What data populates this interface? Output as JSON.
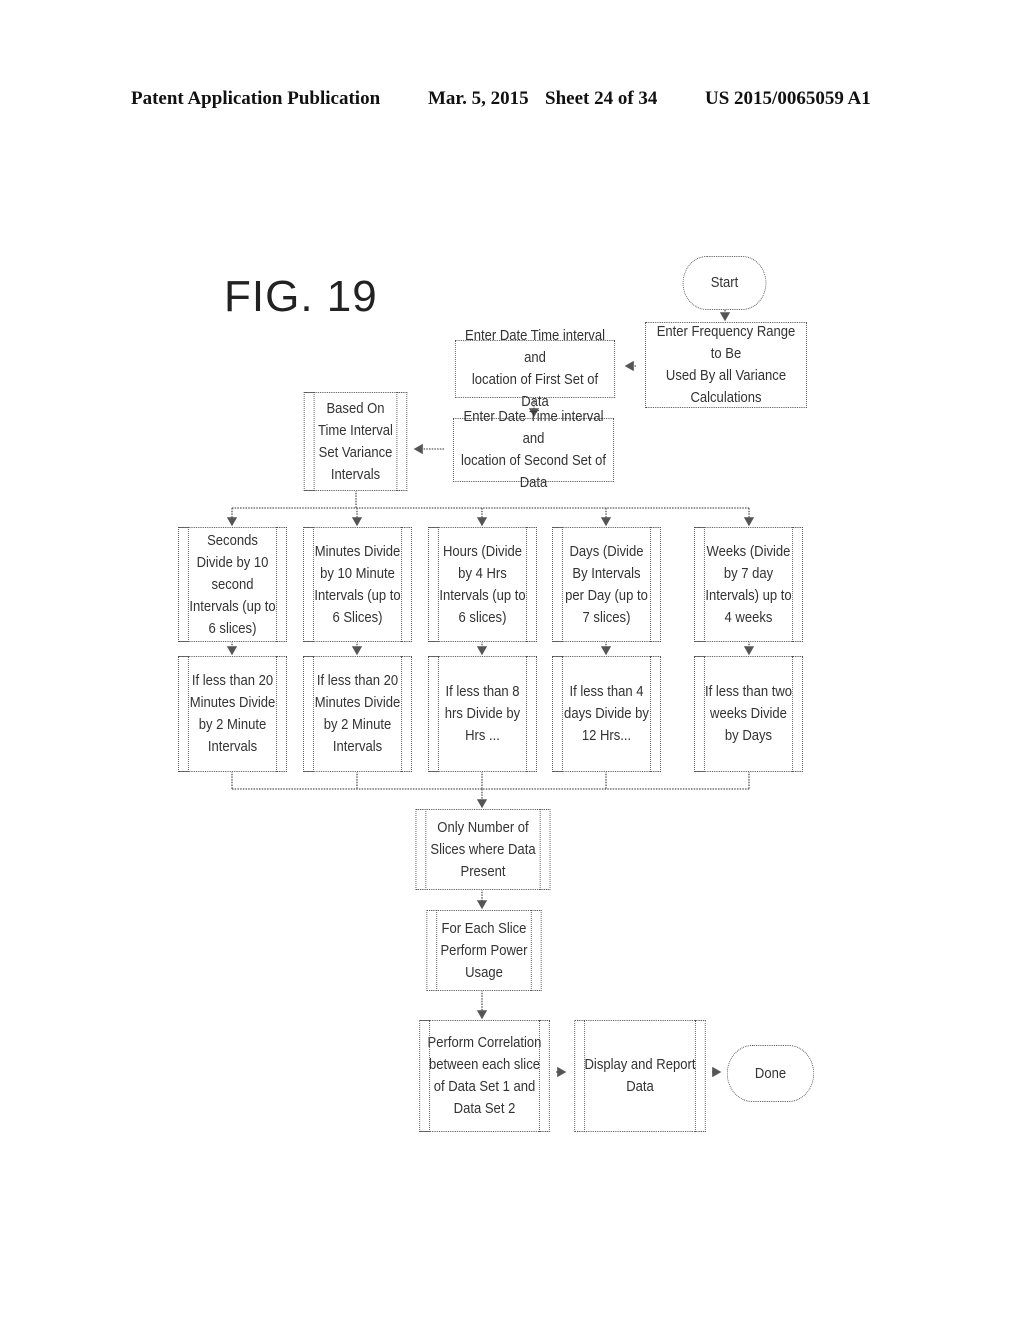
{
  "header": {
    "publication": "Patent Application Publication",
    "date": "Mar. 5, 2015",
    "sheet": "Sheet 24 of 34",
    "number": "US 2015/0065059 A1"
  },
  "figure_label": "FIG. 19",
  "flowchart": {
    "start": "Start",
    "frequency_range": "Enter Frequency Range to Be\nUsed By all Variance\nCalculations",
    "first_set": "Enter Date Time interval and\nlocation of First Set of Data",
    "second_set": "Enter Date Time interval and\nlocation of Second Set of Data",
    "set_intervals": "Based On\nTime Interval\nSet  Variance\nIntervals",
    "branches": [
      {
        "primary": "Seconds\nDivide by 10\nsecond\nIntervals (up to\n6 slices)",
        "secondary": "If less than 20\nMinutes Divide\nby 2 Minute\nIntervals"
      },
      {
        "primary": "Minutes Divide\nby 10 Minute\nIntervals (up to\n6 Slices)",
        "secondary": "If less than 20\nMinutes Divide\nby 2 Minute\nIntervals"
      },
      {
        "primary": "Hours (Divide\nby 4 Hrs\nIntervals (up to\n6 slices)",
        "secondary": "If less than 8\nhrs Divide by\nHrs ..."
      },
      {
        "primary": "Days (Divide\nBy Intervals\nper Day (up to\n7 slices)",
        "secondary": "If less than 4\ndays Divide by\n12 Hrs..."
      },
      {
        "primary": "Weeks (Divide\nby 7 day\nIntervals) up to\n4 weeks",
        "secondary": "If less than two\nweeks Divide\nby Days"
      }
    ],
    "slices_present": "Only Number of\nSlices where Data\nPresent",
    "power_usage": "For Each Slice\nPerform Power\nUsage",
    "correlation": "Perform Correlation\nbetween each slice\nof Data Set 1 and\nData Set 2",
    "display": "Display and Report\nData",
    "done": "Done"
  }
}
